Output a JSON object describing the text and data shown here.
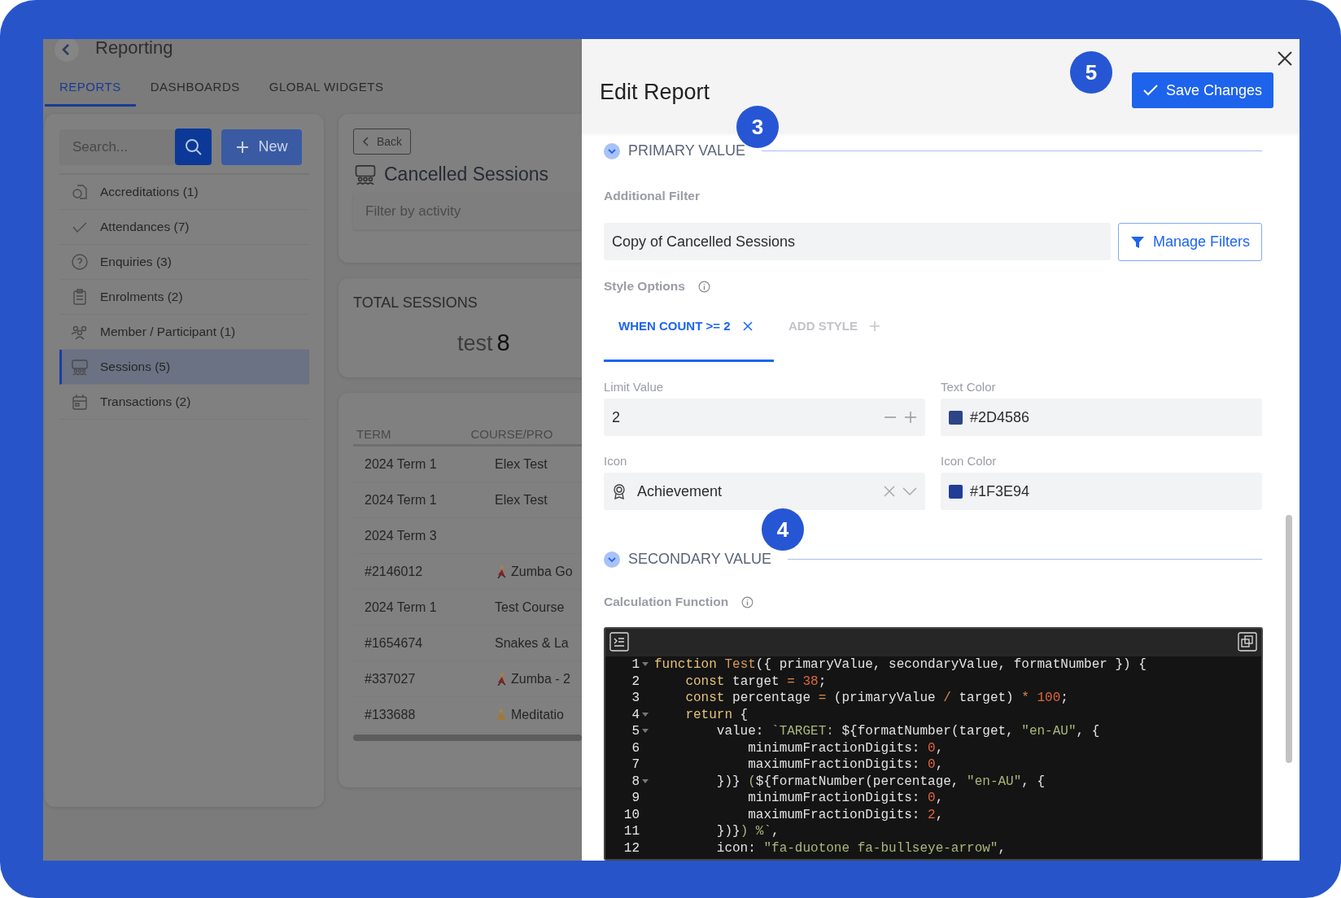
{
  "app": {
    "title": "Reporting",
    "tabs": [
      {
        "label": "REPORTS",
        "selected": true
      },
      {
        "label": "DASHBOARDS",
        "selected": false
      },
      {
        "label": "GLOBAL WIDGETS",
        "selected": false
      }
    ],
    "search": {
      "placeholder": "Search..."
    },
    "new_button": "New",
    "sidebar": {
      "items": [
        {
          "label": "Accreditations (1)",
          "selected": false
        },
        {
          "label": "Attendances (7)",
          "selected": false
        },
        {
          "label": "Enquiries (3)",
          "selected": false
        },
        {
          "label": "Enrolments (2)",
          "selected": false
        },
        {
          "label": "Member / Participant (1)",
          "selected": false
        },
        {
          "label": "Sessions (5)",
          "selected": true
        },
        {
          "label": "Transactions (2)",
          "selected": false
        }
      ]
    },
    "report": {
      "back_button": "Back",
      "title": "Cancelled Sessions",
      "filter": {
        "placeholder": "Filter by activity"
      }
    },
    "summary": {
      "title": "TOTAL SESSIONS",
      "prefix": "test",
      "value": "8"
    },
    "table": {
      "columns": [
        "TERM",
        "COURSE/PRO"
      ],
      "rows": [
        {
          "cells": [
            "2024 Term 1",
            "Elex Test"
          ]
        },
        {
          "cells": [
            "2024 Term 1",
            "Elex Test"
          ]
        },
        {
          "cells": [
            "2024 Term 3",
            ""
          ]
        },
        {
          "cells": [
            "#2146012",
            "Zumba Go"
          ],
          "kind": "dancer"
        },
        {
          "cells": [
            "2024 Term 1",
            "Test Course"
          ]
        },
        {
          "cells": [
            "#1654674",
            "Snakes & La"
          ]
        },
        {
          "cells": [
            "#337027",
            "Zumba - 2"
          ],
          "kind": "dancer"
        },
        {
          "cells": [
            "#133688",
            "Meditatio"
          ],
          "kind": "meditation"
        }
      ]
    }
  },
  "drawer": {
    "title": "Edit Report",
    "save_button": "Save Changes",
    "primary": {
      "heading": "PRIMARY VALUE",
      "expanded": true,
      "filter_label": "Additional Filter",
      "filter_value": "Copy of Cancelled Sessions",
      "manage_button": "Manage Filters",
      "style_label": "Style Options",
      "style_tabs": [
        {
          "label": "WHEN COUNT >= 2",
          "kind": "style",
          "selected": true
        },
        {
          "label": "ADD STYLE",
          "kind": "add",
          "selected": false
        }
      ],
      "limit": {
        "label": "Limit Value",
        "value": "2"
      },
      "text_color": {
        "label": "Text Color",
        "value": "#2D4586",
        "color": "#2d4586"
      },
      "icon": {
        "label": "Icon",
        "value": "Achievement"
      },
      "icon_color": {
        "label": "Icon Color",
        "value": "#1F3E94",
        "color": "#1f3e94"
      }
    },
    "secondary": {
      "heading": "SECONDARY VALUE",
      "expanded": true,
      "function_label": "Calculation Function",
      "code": [
        {
          "number": "1",
          "fold": true,
          "tokens": [
            {
              "kind": "keyword",
              "text": "function "
            },
            {
              "kind": "name",
              "text": "Test"
            },
            {
              "kind": "plain",
              "text": "({ primaryValue, secondaryValue, formatNumber }) {"
            }
          ]
        },
        {
          "number": "2",
          "fold": false,
          "tokens": [
            {
              "kind": "keyword",
              "text": "    const"
            },
            {
              "kind": "plain",
              "text": " target "
            },
            {
              "kind": "operator",
              "text": "= "
            },
            {
              "kind": "number",
              "text": "38"
            },
            {
              "kind": "plain",
              "text": ";"
            }
          ]
        },
        {
          "number": "3",
          "fold": false,
          "tokens": [
            {
              "kind": "keyword",
              "text": "    const"
            },
            {
              "kind": "plain",
              "text": " percentage "
            },
            {
              "kind": "operator",
              "text": "="
            },
            {
              "kind": "plain",
              "text": " (primaryValue "
            },
            {
              "kind": "operator",
              "text": "/"
            },
            {
              "kind": "plain",
              "text": " target) "
            },
            {
              "kind": "operator",
              "text": "* "
            },
            {
              "kind": "number",
              "text": "100"
            },
            {
              "kind": "plain",
              "text": ";"
            }
          ]
        },
        {
          "number": "4",
          "fold": true,
          "tokens": [
            {
              "kind": "keyword",
              "text": "    return"
            },
            {
              "kind": "plain",
              "text": " {"
            }
          ]
        },
        {
          "number": "5",
          "fold": true,
          "tokens": [
            {
              "kind": "plain",
              "text": "        value: "
            },
            {
              "kind": "string",
              "text": "`TARGET: "
            },
            {
              "kind": "plain",
              "text": "${formatNumber(target, "
            },
            {
              "kind": "string",
              "text": "\"en-AU\""
            },
            {
              "kind": "plain",
              "text": ", {"
            }
          ]
        },
        {
          "number": "6",
          "fold": false,
          "tokens": [
            {
              "kind": "plain",
              "text": "            minimumFractionDigits: "
            },
            {
              "kind": "number",
              "text": "0"
            },
            {
              "kind": "plain",
              "text": ","
            }
          ]
        },
        {
          "number": "7",
          "fold": false,
          "tokens": [
            {
              "kind": "plain",
              "text": "            maximumFractionDigits: "
            },
            {
              "kind": "number",
              "text": "0"
            },
            {
              "kind": "plain",
              "text": ","
            }
          ]
        },
        {
          "number": "8",
          "fold": true,
          "tokens": [
            {
              "kind": "plain",
              "text": "        })}"
            },
            {
              "kind": "string",
              "text": " ("
            },
            {
              "kind": "plain",
              "text": "${formatNumber(percentage, "
            },
            {
              "kind": "string",
              "text": "\"en-AU\""
            },
            {
              "kind": "plain",
              "text": ", {"
            }
          ]
        },
        {
          "number": "9",
          "fold": false,
          "tokens": [
            {
              "kind": "plain",
              "text": "            minimumFractionDigits: "
            },
            {
              "kind": "number",
              "text": "0"
            },
            {
              "kind": "plain",
              "text": ","
            }
          ]
        },
        {
          "number": "10",
          "fold": false,
          "tokens": [
            {
              "kind": "plain",
              "text": "            maximumFractionDigits: "
            },
            {
              "kind": "number",
              "text": "2"
            },
            {
              "kind": "plain",
              "text": ","
            }
          ]
        },
        {
          "number": "11",
          "fold": false,
          "tokens": [
            {
              "kind": "plain",
              "text": "        })}"
            },
            {
              "kind": "string",
              "text": ") %`"
            },
            {
              "kind": "plain",
              "text": ","
            }
          ]
        },
        {
          "number": "12",
          "fold": false,
          "tokens": [
            {
              "kind": "plain",
              "text": "        icon: "
            },
            {
              "kind": "string",
              "text": "\"fa-duotone fa-bullseye-arrow\""
            },
            {
              "kind": "plain",
              "text": ","
            }
          ]
        }
      ]
    }
  },
  "callouts": [
    {
      "label": "3"
    },
    {
      "label": "4"
    },
    {
      "label": "5"
    }
  ]
}
